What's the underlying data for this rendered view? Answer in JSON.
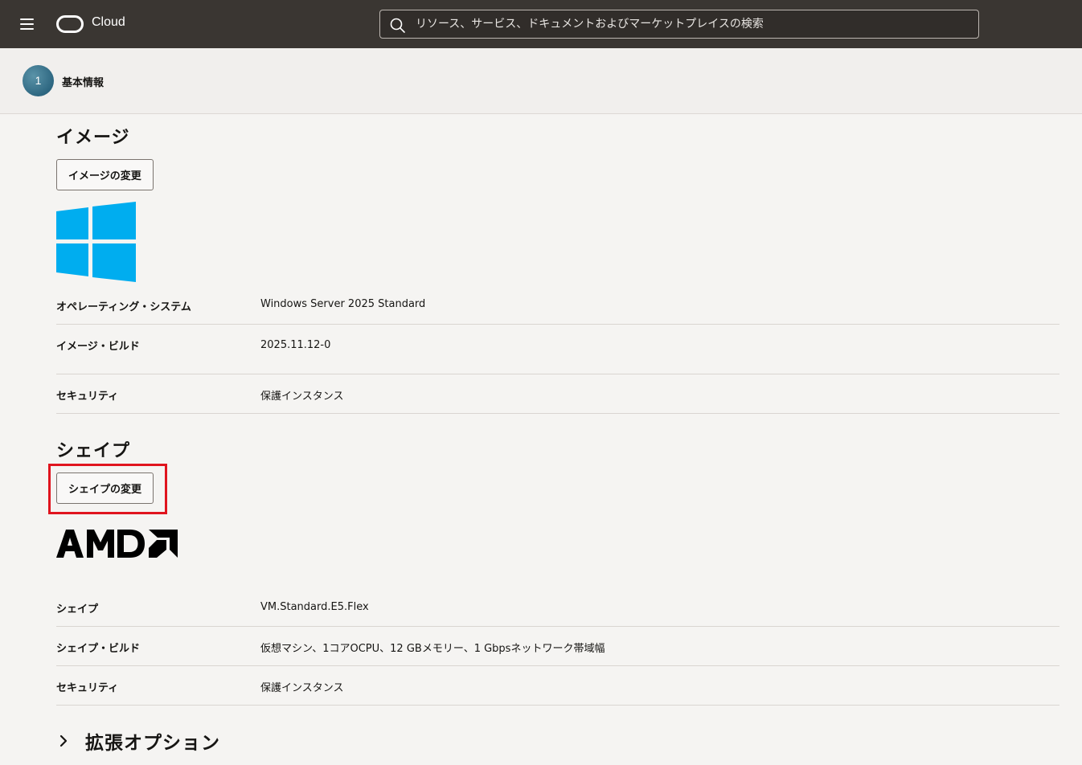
{
  "header": {
    "brand": "Cloud",
    "search_placeholder": "リソース、サービス、ドキュメントおよびマーケットプレイスの検索",
    "colors": {
      "bar": "#3a3632",
      "text": "#ffffff"
    }
  },
  "steps": [
    {
      "number": "1",
      "label": "基本情報"
    }
  ],
  "image_section": {
    "title": "イメージ",
    "change_button": "イメージの変更",
    "logo_icon": "windows-logo",
    "rows": [
      {
        "label": "オペレーティング・システム",
        "value": "Windows Server 2025 Standard"
      },
      {
        "label": "イメージ・ビルド",
        "value": "2025.11.12-0"
      },
      {
        "label": "セキュリティ",
        "value": "保護インスタンス"
      }
    ]
  },
  "shape_section": {
    "title": "シェイプ",
    "change_button": "シェイプの変更",
    "logo_icon": "amd-logo",
    "rows": [
      {
        "label": "シェイプ",
        "value": "VM.Standard.E5.Flex"
      },
      {
        "label": "シェイプ・ビルド",
        "value": "仮想マシン、1コアOCPU、12 GBメモリー、1 Gbpsネットワーク帯域幅"
      },
      {
        "label": "セキュリティ",
        "value": "保護インスタンス"
      }
    ]
  },
  "advanced": {
    "title": "拡張オプション"
  },
  "accent_colors": {
    "highlight": "#e0141e",
    "windows": "#00adef",
    "step": "#2e6781"
  }
}
